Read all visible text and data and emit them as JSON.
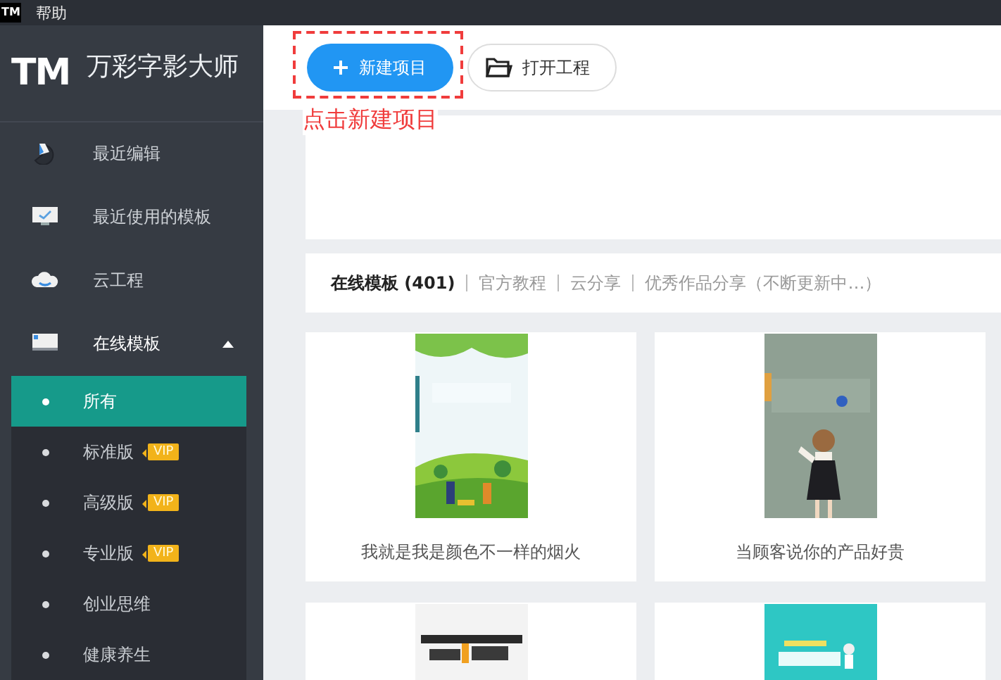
{
  "menu_bar": {
    "app_icon": "TM",
    "items": [
      {
        "label": "帮助"
      }
    ]
  },
  "sidebar": {
    "logo": "TM",
    "app_name": "万彩字影大师",
    "items": [
      {
        "label": "最近编辑"
      },
      {
        "label": "最近使用的模板"
      },
      {
        "label": "云工程"
      },
      {
        "label": "在线模板",
        "expanded": true,
        "children": [
          {
            "label": "所有",
            "selected": true
          },
          {
            "label": "标准版",
            "selected": false,
            "badge": "VIP"
          },
          {
            "label": "高级版",
            "selected": false,
            "badge": "VIP"
          },
          {
            "label": "专业版",
            "selected": false,
            "badge": "VIP"
          },
          {
            "label": "创业思维",
            "selected": false
          },
          {
            "label": "健康养生",
            "selected": false
          }
        ]
      }
    ]
  },
  "toolbar": {
    "buttons": [
      {
        "label": "新建项目",
        "kind": "primary"
      },
      {
        "label": "打开工程",
        "kind": "secondary"
      }
    ]
  },
  "annotation": {
    "text": "点击新建项目"
  },
  "tabs": [
    {
      "label": "在线模板 (401)",
      "selected": true
    },
    {
      "label": "官方教程",
      "selected": false
    },
    {
      "label": "云分享",
      "selected": false
    },
    {
      "label": "优秀作品分享（不断更新中…）",
      "selected": false
    }
  ],
  "templates": [
    {
      "kind": "picture",
      "title": "我就是我是颜色不一样的烟火"
    },
    {
      "kind": "picture",
      "title": "当顾客说你的产品好贵"
    },
    {
      "kind": "picture"
    },
    {
      "kind": "picture"
    }
  ]
}
